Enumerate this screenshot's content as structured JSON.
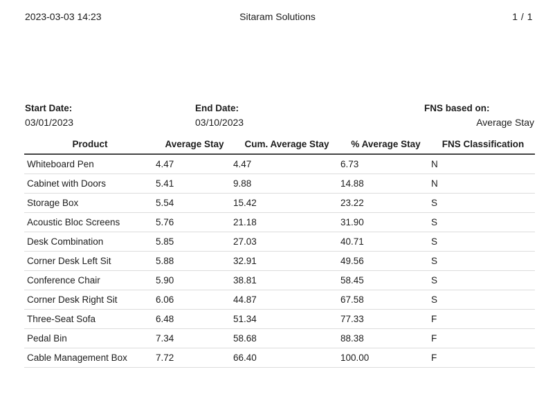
{
  "header": {
    "datetime": "2023-03-03 14:23",
    "company": "Sitaram Solutions",
    "page": "1 / 1"
  },
  "filters": {
    "start_label": "Start Date:",
    "start_value": "03/01/2023",
    "end_label": "End Date:",
    "end_value": "03/10/2023",
    "fns_label": "FNS based on:",
    "fns_value": "Average Stay"
  },
  "table": {
    "columns": [
      "Product",
      "Average Stay",
      "Cum. Average Stay",
      "% Average Stay",
      "FNS Classification"
    ],
    "rows": [
      [
        "Whiteboard Pen",
        "4.47",
        "4.47",
        "6.73",
        "N"
      ],
      [
        "Cabinet with Doors",
        "5.41",
        "9.88",
        "14.88",
        "N"
      ],
      [
        "Storage Box",
        "5.54",
        "15.42",
        "23.22",
        "S"
      ],
      [
        "Acoustic Bloc Screens",
        "5.76",
        "21.18",
        "31.90",
        "S"
      ],
      [
        "Desk Combination",
        "5.85",
        "27.03",
        "40.71",
        "S"
      ],
      [
        "Corner Desk Left Sit",
        "5.88",
        "32.91",
        "49.56",
        "S"
      ],
      [
        "Conference Chair",
        "5.90",
        "38.81",
        "58.45",
        "S"
      ],
      [
        "Corner Desk Right Sit",
        "6.06",
        "44.87",
        "67.58",
        "S"
      ],
      [
        "Three-Seat Sofa",
        "6.48",
        "51.34",
        "77.33",
        "F"
      ],
      [
        "Pedal Bin",
        "7.34",
        "58.68",
        "88.38",
        "F"
      ],
      [
        "Cable Management Box",
        "7.72",
        "66.40",
        "100.00",
        "F"
      ]
    ]
  }
}
